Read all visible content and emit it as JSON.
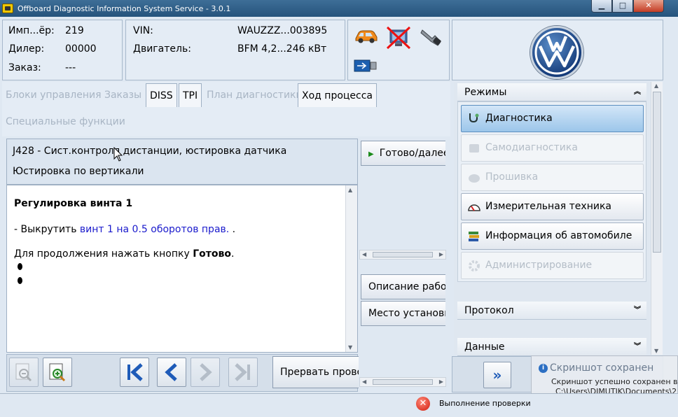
{
  "window": {
    "title": "Offboard Diagnostic Information System Service - 3.0.1",
    "minimize": "▁",
    "maximize": "□",
    "close": "✕"
  },
  "order_info": {
    "rows": [
      {
        "label": "Имп...ёр:",
        "value": "219"
      },
      {
        "label": "Дилер:",
        "value": "00000"
      },
      {
        "label": "Заказ:",
        "value": "---"
      }
    ]
  },
  "vehicle_info": {
    "rows": [
      {
        "label": "VIN:",
        "value": "WAUZZZ...003895"
      },
      {
        "label": "Двигатель:",
        "value": "BFM 4,2...246 кВт"
      }
    ]
  },
  "tabs": [
    {
      "label": "Блоки управления",
      "active": false
    },
    {
      "label": "Заказы",
      "active": false
    },
    {
      "label": "DISS",
      "active": true
    },
    {
      "label": "TPI",
      "active": true
    },
    {
      "label": "План диагностики",
      "active": false
    },
    {
      "label": "Ход процесса",
      "active": true
    },
    {
      "label": "Специальные функции",
      "active": false
    }
  ],
  "test": {
    "header_line1": "J428 - Сист.контроля дистанции, юстировка датчика",
    "header_line2": "Юстировка по вертикали",
    "title": "Регулировка винта 1",
    "step_prefix": "- Выкрутить",
    "step_link": "винт 1 на 0.5  оборотов   прав.",
    "step_suffix": " .",
    "continue_prefix": "Для продолжения нажать кнопку ",
    "continue_bold": "Готово",
    "continue_suffix": "."
  },
  "side_buttons": {
    "ready": "Готово/далее",
    "description": "Описание работы",
    "location": "Место установки"
  },
  "toolbar": {
    "abort": "Прервать проверку"
  },
  "modes": {
    "header": "Режимы",
    "items": [
      {
        "label": "Диагностика",
        "state": "active"
      },
      {
        "label": "Самодиагностика",
        "state": "disabled"
      },
      {
        "label": "Прошивка",
        "state": "disabled"
      },
      {
        "label": "Измерительная техника",
        "state": "enabled"
      },
      {
        "label": "Информация об автомобиле",
        "state": "enabled"
      },
      {
        "label": "Администрирование",
        "state": "disabled"
      }
    ]
  },
  "protocol": {
    "header": "Протокол"
  },
  "data_section": {
    "header": "Данные"
  },
  "notification": {
    "title": "Скриншот сохранен",
    "line1": "Скриншот успешно сохранен в",
    "line2": "C:\\Users\\DIMUTIK\\Documents\\2"
  },
  "status": {
    "text": "Выполнение проверки"
  },
  "colors": {
    "link": "#1a1acc",
    "accent": "#4f88c6"
  }
}
